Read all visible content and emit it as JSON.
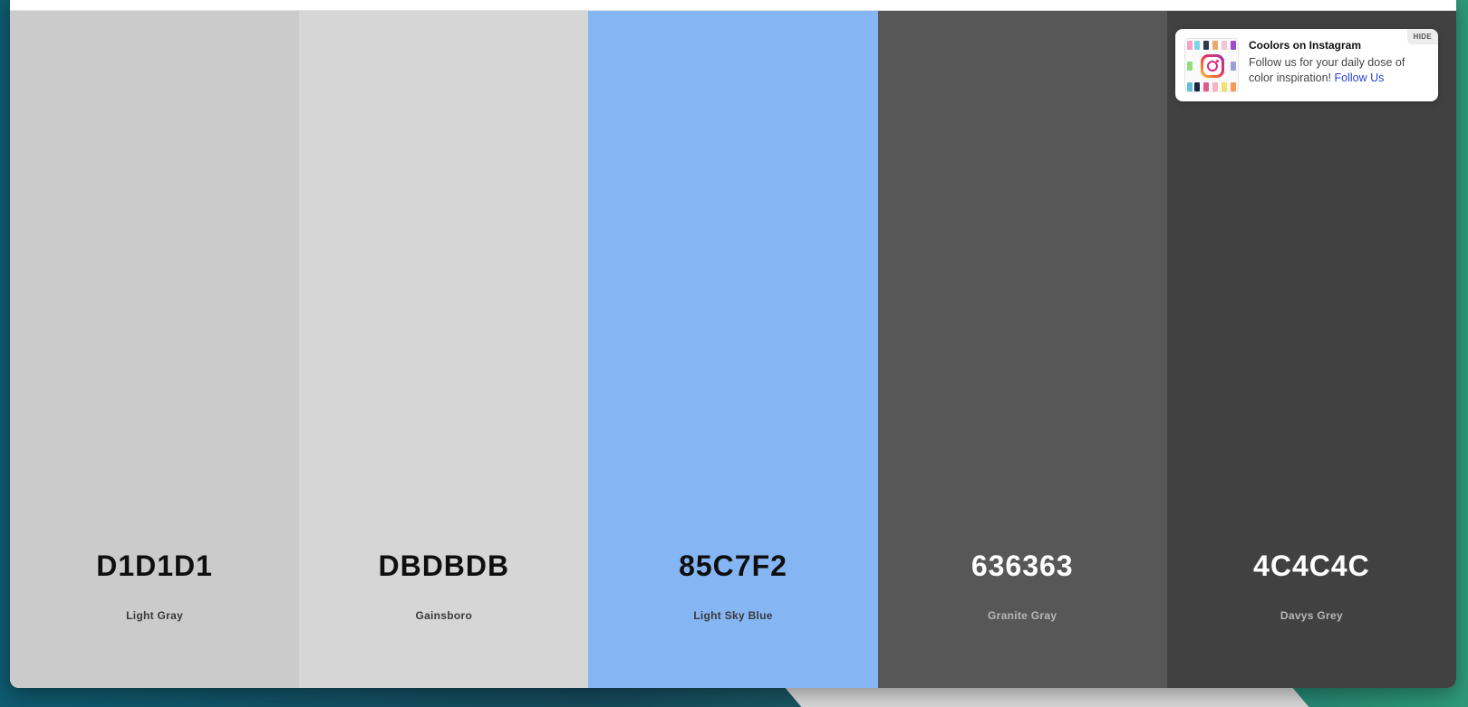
{
  "palette": [
    {
      "hex": "D1D1D1",
      "name": "Light Gray",
      "color": "#CBCBCB",
      "text_style": "dark"
    },
    {
      "hex": "DBDBDB",
      "name": "Gainsboro",
      "color": "#D6D6D6",
      "text_style": "dark"
    },
    {
      "hex": "85C7F2",
      "name": "Light Sky Blue",
      "color": "#85B6F3",
      "text_style": "dark"
    },
    {
      "hex": "636363",
      "name": "Granite Gray",
      "color": "#575757",
      "text_style": "light"
    },
    {
      "hex": "4C4C4C",
      "name": "Davys Grey",
      "color": "#414141",
      "text_style": "light"
    }
  ],
  "instagram_promo": {
    "title": "Coolors on Instagram",
    "body": "Follow us for your daily dose of color inspiration!",
    "link_label": "Follow Us",
    "hide_label": "HIDE",
    "link_color": "#2B41D9"
  },
  "icons": {
    "promo_thumb": "instagram-icon"
  }
}
